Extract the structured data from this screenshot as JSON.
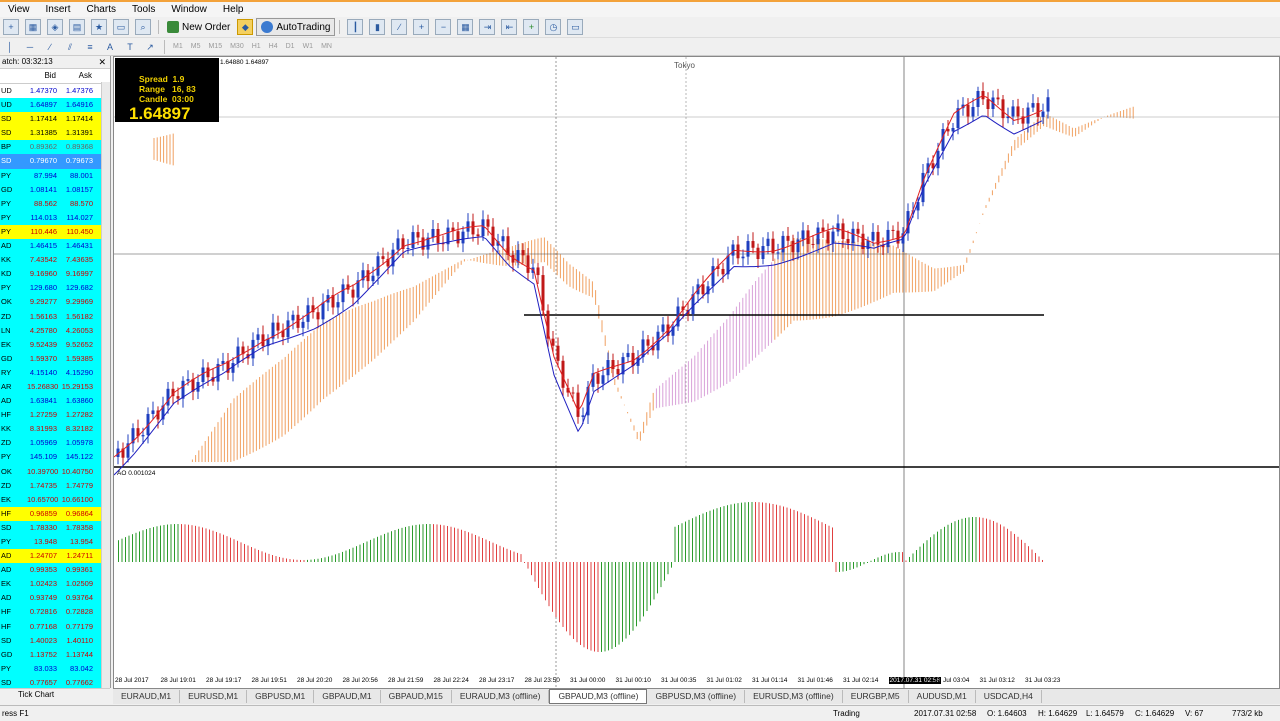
{
  "menu": [
    "View",
    "Insert",
    "Charts",
    "Tools",
    "Window",
    "Help"
  ],
  "toolbar": {
    "new_order": "New Order",
    "autotrading": "AutoTrading"
  },
  "timeframes": [
    "M1",
    "M5",
    "M15",
    "M30",
    "H1",
    "H4",
    "D1",
    "W1",
    "MN"
  ],
  "market_watch": {
    "title": "atch: 03:32:13",
    "col_bid": "Bid",
    "col_ask": "Ask",
    "tab": "Tick Chart",
    "rows": [
      {
        "sym": "UD",
        "bid": "1.47370",
        "ask": "1.47376",
        "bg": "#ffffff",
        "fg": "#0000cc"
      },
      {
        "sym": "UD",
        "bid": "1.64897",
        "ask": "1.64916",
        "bg": "#00ffff",
        "fg": "#0000cc"
      },
      {
        "sym": "SD",
        "bid": "1.17414",
        "ask": "1.17414",
        "bg": "#ffff00",
        "fg": "#000000"
      },
      {
        "sym": "SD",
        "bid": "1.31385",
        "ask": "1.31391",
        "bg": "#ffff00",
        "fg": "#000000"
      },
      {
        "sym": "BP",
        "bid": "0.89362",
        "ask": "0.89368",
        "bg": "#00ffff",
        "fg": "#666666"
      },
      {
        "sym": "SD",
        "bid": "0.79670",
        "ask": "0.79673",
        "bg": "#3399ff",
        "fg": "#ffffff"
      },
      {
        "sym": "PY",
        "bid": "87.994",
        "ask": "88.001",
        "bg": "#00ffff",
        "fg": "#0000cc"
      },
      {
        "sym": "GD",
        "bid": "1.08141",
        "ask": "1.08157",
        "bg": "#00ffff",
        "fg": "#0000cc"
      },
      {
        "sym": "PY",
        "bid": "88.562",
        "ask": "88.570",
        "bg": "#00ffff",
        "fg": "#cc0000"
      },
      {
        "sym": "PY",
        "bid": "114.013",
        "ask": "114.027",
        "bg": "#00ffff",
        "fg": "#0000cc"
      },
      {
        "sym": "PY",
        "bid": "110.446",
        "ask": "110.450",
        "bg": "#ffff00",
        "fg": "#cc0000"
      },
      {
        "sym": "AD",
        "bid": "1.46415",
        "ask": "1.46431",
        "bg": "#00ffff",
        "fg": "#0000cc"
      },
      {
        "sym": "KK",
        "bid": "7.43542",
        "ask": "7.43635",
        "bg": "#00ffff",
        "fg": "#cc0000"
      },
      {
        "sym": "KD",
        "bid": "9.16960",
        "ask": "9.16997",
        "bg": "#00ffff",
        "fg": "#cc0000"
      },
      {
        "sym": "PY",
        "bid": "129.680",
        "ask": "129.682",
        "bg": "#00ffff",
        "fg": "#0000cc"
      },
      {
        "sym": "OK",
        "bid": "9.29277",
        "ask": "9.29969",
        "bg": "#00ffff",
        "fg": "#cc0000"
      },
      {
        "sym": "ZD",
        "bid": "1.56163",
        "ask": "1.56182",
        "bg": "#00ffff",
        "fg": "#cc0000"
      },
      {
        "sym": "LN",
        "bid": "4.25780",
        "ask": "4.26053",
        "bg": "#00ffff",
        "fg": "#cc0000"
      },
      {
        "sym": "EK",
        "bid": "9.52439",
        "ask": "9.52652",
        "bg": "#00ffff",
        "fg": "#cc0000"
      },
      {
        "sym": "GD",
        "bid": "1.59370",
        "ask": "1.59385",
        "bg": "#00ffff",
        "fg": "#cc0000"
      },
      {
        "sym": "RY",
        "bid": "4.15140",
        "ask": "4.15290",
        "bg": "#00ffff",
        "fg": "#0000cc"
      },
      {
        "sym": "AR",
        "bid": "15.26830",
        "ask": "15.29153",
        "bg": "#00ffff",
        "fg": "#cc0000"
      },
      {
        "sym": "AD",
        "bid": "1.63841",
        "ask": "1.63860",
        "bg": "#00ffff",
        "fg": "#0000cc"
      },
      {
        "sym": "HF",
        "bid": "1.27259",
        "ask": "1.27282",
        "bg": "#00ffff",
        "fg": "#cc0000"
      },
      {
        "sym": "KK",
        "bid": "8.31993",
        "ask": "8.32182",
        "bg": "#00ffff",
        "fg": "#cc0000"
      },
      {
        "sym": "ZD",
        "bid": "1.05969",
        "ask": "1.05978",
        "bg": "#00ffff",
        "fg": "#0000cc"
      },
      {
        "sym": "PY",
        "bid": "145.109",
        "ask": "145.122",
        "bg": "#00ffff",
        "fg": "#0000cc"
      },
      {
        "sym": "OK",
        "bid": "10.39700",
        "ask": "10.40750",
        "bg": "#00ffff",
        "fg": "#cc0000"
      },
      {
        "sym": "ZD",
        "bid": "1.74735",
        "ask": "1.74779",
        "bg": "#00ffff",
        "fg": "#cc0000"
      },
      {
        "sym": "EK",
        "bid": "10.65700",
        "ask": "10.66100",
        "bg": "#00ffff",
        "fg": "#cc0000"
      },
      {
        "sym": "HF",
        "bid": "0.96859",
        "ask": "0.96864",
        "bg": "#ffff00",
        "fg": "#cc0000"
      },
      {
        "sym": "SD",
        "bid": "1.78330",
        "ask": "1.78358",
        "bg": "#00ffff",
        "fg": "#cc0000"
      },
      {
        "sym": "PY",
        "bid": "13.948",
        "ask": "13.954",
        "bg": "#00ffff",
        "fg": "#cc0000"
      },
      {
        "sym": "AD",
        "bid": "1.24707",
        "ask": "1.24711",
        "bg": "#ffff00",
        "fg": "#cc0000"
      },
      {
        "sym": "AD",
        "bid": "0.99353",
        "ask": "0.99361",
        "bg": "#00ffff",
        "fg": "#cc0000"
      },
      {
        "sym": "EK",
        "bid": "1.02423",
        "ask": "1.02509",
        "bg": "#00ffff",
        "fg": "#cc0000"
      },
      {
        "sym": "AD",
        "bid": "0.93749",
        "ask": "0.93764",
        "bg": "#00ffff",
        "fg": "#cc0000"
      },
      {
        "sym": "HF",
        "bid": "0.72816",
        "ask": "0.72828",
        "bg": "#00ffff",
        "fg": "#cc0000"
      },
      {
        "sym": "HF",
        "bid": "0.77168",
        "ask": "0.77179",
        "bg": "#00ffff",
        "fg": "#cc0000"
      },
      {
        "sym": "SD",
        "bid": "1.40023",
        "ask": "1.40110",
        "bg": "#00ffff",
        "fg": "#cc0000"
      },
      {
        "sym": "GD",
        "bid": "1.13752",
        "ask": "1.13744",
        "bg": "#00ffff",
        "fg": "#cc0000"
      },
      {
        "sym": "PY",
        "bid": "83.033",
        "ask": "83.042",
        "bg": "#00ffff",
        "fg": "#0000cc"
      },
      {
        "sym": "SD",
        "bid": "0.77657",
        "ask": "0.77662",
        "bg": "#00ffff",
        "fg": "#cc0000"
      }
    ]
  },
  "chart": {
    "ohlc_label": "1.64880 1.64897",
    "info": {
      "spread_line": "Spread  1.9",
      "range_line": "Range   16, 83",
      "candle_line": "Candle  03:00",
      "price": "1.64897"
    },
    "session_label": "Tokyo",
    "ao_label": "AO 0.001024",
    "x_labels": [
      "28 Jul 2017",
      "28 Jul 19:01",
      "28 Jul 19:17",
      "28 Jul 19:51",
      "28 Jul 20:20",
      "28 Jul 20:56",
      "28 Jul 21:59",
      "28 Jul 22:24",
      "28 Jul 23:17",
      "28 Jul 23:50",
      "31 Jul 00:00",
      "31 Jul 00:10",
      "31 Jul 00:35",
      "31 Jul 01:02",
      "31 Jul 01:14",
      "31 Jul 01:46",
      "31 Jul 02:14",
      "2017.07.31 02:58",
      "31 Jul 03:04",
      "31 Jul 03:12",
      "31 Jul 03:23"
    ],
    "colors": {
      "bull": "#1f3fbf",
      "bear": "#c01818",
      "tenkan": "#e02020",
      "kijun": "#2020c0",
      "cloud_up": "#f0a060",
      "cloud_down": "#d8a0d8",
      "ao_up": "#2a9a2a",
      "ao_down": "#e04040"
    }
  },
  "tabs": [
    "EURAUD,M1",
    "EURUSD,M1",
    "GBPUSD,M1",
    "GBPAUD,M1",
    "GBPAUD,M15",
    "EURAUD,M3 (offline)",
    "GBPAUD,M3 (offline)",
    "GBPUSD,M3 (offline)",
    "EURUSD,M3 (offline)",
    "EURGBP,M5",
    "AUDUSD,M1",
    "USDCAD,H4"
  ],
  "active_tab": 6,
  "status": {
    "help": "ress F1",
    "mode": "Trading",
    "datetime": "2017.07.31 02:58",
    "open": "O: 1.64603",
    "high": "H: 1.64629",
    "low": "L: 1.64579",
    "close": "C: 1.64629",
    "volume": "V: 67",
    "traffic": "773/2 kb"
  }
}
